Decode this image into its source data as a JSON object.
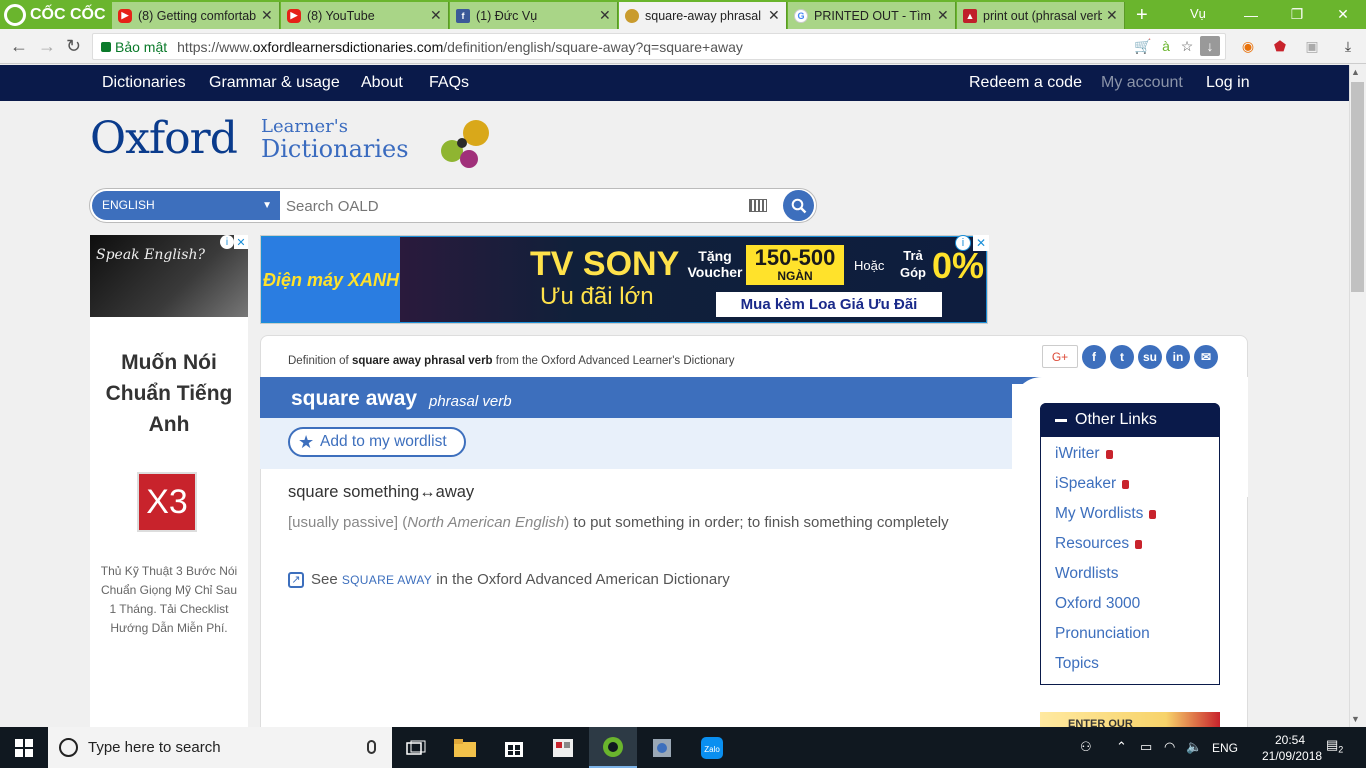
{
  "browser": {
    "brand": "CỐC CỐC",
    "tabs": [
      {
        "title": "(8) Getting comfortab",
        "icon": "youtube-icon",
        "active": false
      },
      {
        "title": "(8) YouTube",
        "icon": "youtube-icon",
        "active": false
      },
      {
        "title": "(1) Đức Vụ",
        "icon": "facebook-icon",
        "active": false
      },
      {
        "title": "square-away phrasal v",
        "icon": "oxford-icon",
        "active": true
      },
      {
        "title": "PRINTED OUT - Tìm v",
        "icon": "google-icon",
        "active": false
      },
      {
        "title": "print out (phrasal verb",
        "icon": "ldoceonline-icon",
        "active": false
      }
    ],
    "new_tab": "+",
    "profile": "Vụ",
    "security_label": "Bảo mật",
    "url_prefix": "https://www.",
    "url_domain": "oxfordlearnersdictionaries.com",
    "url_path": "/definition/english/square-away?q=square+away"
  },
  "nav": {
    "left": [
      "Dictionaries",
      "Grammar & usage",
      "About",
      "FAQs"
    ],
    "redeem": "Redeem a code",
    "account": "My account",
    "login": "Log in"
  },
  "logo": {
    "oxford": "Oxford",
    "learners": "Learner's",
    "dictionaries": "Dictionaries"
  },
  "search": {
    "language": "ENGLISH",
    "placeholder": "Search OALD"
  },
  "ad_left": {
    "image_text": "Speak English?",
    "heading": "Muốn Nói Chuẩn Tiếng Anh",
    "badge": "X3",
    "text": "Thủ Kỹ Thuật 3 Bước Nói Chuẩn Giọng Mỹ Chỉ Sau 1 Tháng. Tải Checklist Hướng Dẫn Miễn Phí."
  },
  "ad_banner": {
    "brand": "Điện máy XANH",
    "title": "TV SONY",
    "subtitle": "Ưu đãi lớn",
    "voucher": "Tặng Voucher",
    "price": "150-500",
    "price_unit": "NGÀN",
    "or": "Hoặc",
    "installment": "Trả Góp",
    "zero": "0%",
    "cta": "Mua kèm Loa Giá Ưu Đãi"
  },
  "entry": {
    "source_prefix": "Definition of ",
    "source_bold": "square away phrasal verb",
    "source_suffix": " from the Oxford Advanced Learner's Dictionary",
    "headword": "square away",
    "pos": "phrasal verb",
    "wordlist_btn": "Add to my wordlist",
    "phrase": "square something↔away",
    "grammar": "[usually passive]",
    "label_open": "(",
    "label": "North American English",
    "label_close": ")",
    "definition": " to put something in order; to finish something completely",
    "see_prefix": "See ",
    "see_link": "square away",
    "see_suffix": " in the Oxford Advanced American Dictionary"
  },
  "share": [
    "G+",
    "f",
    "t",
    "su",
    "in",
    "✉"
  ],
  "other_links": {
    "title": "Other Links",
    "items": [
      {
        "label": "iWriter",
        "locked": true
      },
      {
        "label": "iSpeaker",
        "locked": true
      },
      {
        "label": "My Wordlists",
        "locked": true
      },
      {
        "label": "Resources",
        "locked": true
      },
      {
        "label": "Wordlists",
        "locked": false
      },
      {
        "label": "Oxford 3000",
        "locked": false
      },
      {
        "label": "Pronunciation",
        "locked": false
      },
      {
        "label": "Topics",
        "locked": false
      }
    ],
    "promo": "ENTER OUR"
  },
  "taskbar": {
    "search_placeholder": "Type here to search",
    "lang": "ENG",
    "time": "20:54",
    "date": "21/09/2018",
    "notifications": "2"
  },
  "colors": {
    "tabstrip": "#6ab52d",
    "nav": "#0a1a4a",
    "accent": "#3d6fbd"
  }
}
